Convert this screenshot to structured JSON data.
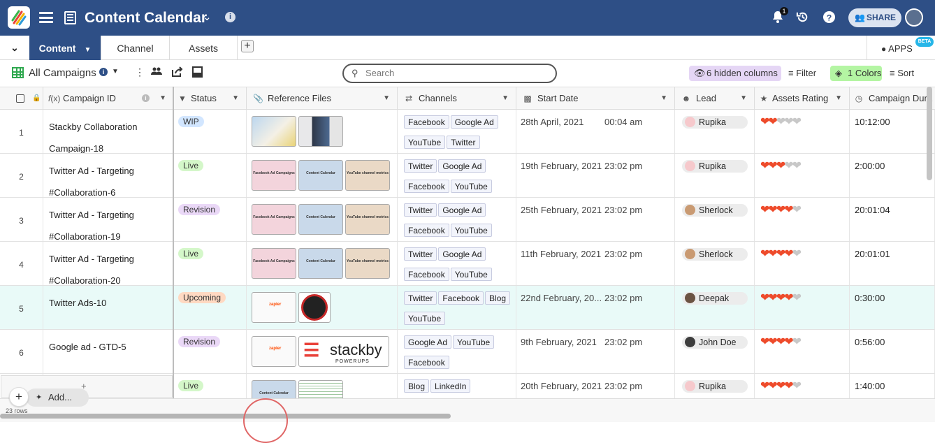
{
  "app": {
    "title": "Content Calendar",
    "notification_count": "1",
    "share_label": "SHARE"
  },
  "tabs": [
    {
      "label": "Content",
      "active": true
    },
    {
      "label": "Channel",
      "active": false
    },
    {
      "label": "Assets",
      "active": false
    }
  ],
  "apps": {
    "label": "APPS",
    "badge": "BETA"
  },
  "toolbar": {
    "view_name": "All Campaigns",
    "search_placeholder": "Search",
    "hidden_columns": "6 hidden columns",
    "filter": "Filter",
    "colors": "1 Colors",
    "sort": "Sort"
  },
  "columns": [
    {
      "label": "Campaign ID",
      "icon": "formula-icon"
    },
    {
      "label": "Status",
      "icon": "status-icon"
    },
    {
      "label": "Reference Files",
      "icon": "attachment-icon"
    },
    {
      "label": "Channels",
      "icon": "link-icon"
    },
    {
      "label": "Start Date",
      "icon": "calendar-icon"
    },
    {
      "label": "Lead",
      "icon": "person-icon"
    },
    {
      "label": "Assets Rating",
      "icon": "star-icon"
    },
    {
      "label": "Campaign Dura",
      "icon": "clock-icon"
    }
  ],
  "rows": [
    {
      "num": "1",
      "id1": "Stackby Collaboration",
      "id2": "Campaign-18",
      "status": "WIP",
      "status_color": "#d2e6ff",
      "files": [
        "photo-desk",
        "photo-laptop"
      ],
      "channels": [
        "Facebook",
        "Google Ad",
        "YouTube",
        "Twitter"
      ],
      "date": "28th April, 2021",
      "time": "00:04 am",
      "lead": "Rupika",
      "lead_color": "#f6c9cc",
      "rating": 2,
      "duration": "10:12:00"
    },
    {
      "num": "2",
      "id1": "Twitter Ad - Targeting",
      "id2": "#Collaboration-6",
      "status": "Live",
      "status_color": "#d4f7c9",
      "files": [
        "facebook-ad-campaigns",
        "content-calendar",
        "youtube-channel-metrics"
      ],
      "channels": [
        "Twitter",
        "Google Ad",
        "Facebook",
        "YouTube"
      ],
      "date": "19th February, 2021",
      "time": "23:02 pm",
      "lead": "Rupika",
      "lead_color": "#f6c9cc",
      "rating": 3,
      "duration": "2:00:00"
    },
    {
      "num": "3",
      "id1": "Twitter Ad - Targeting",
      "id2": "#Collaboration-19",
      "status": "Revision",
      "status_color": "#ead8f7",
      "files": [
        "facebook-ad-campaigns",
        "content-calendar",
        "youtube-channel-metrics"
      ],
      "channels": [
        "Twitter",
        "Google Ad",
        "Facebook",
        "YouTube"
      ],
      "date": "25th February, 2021",
      "time": "23:02 pm",
      "lead": "Sherlock",
      "lead_color": "#c99a72",
      "rating": 4,
      "duration": "20:01:04"
    },
    {
      "num": "4",
      "id1": "Twitter Ad - Targeting",
      "id2": "#Collaboration-20",
      "status": "Live",
      "status_color": "#d4f7c9",
      "files": [
        "facebook-ad-campaigns",
        "content-calendar",
        "youtube-channel-metrics"
      ],
      "channels": [
        "Twitter",
        "Google Ad",
        "Facebook",
        "YouTube"
      ],
      "date": "11th February, 2021",
      "time": "23:02 pm",
      "lead": "Sherlock",
      "lead_color": "#c99a72",
      "rating": 4,
      "duration": "20:01:01"
    },
    {
      "num": "5",
      "id1": "Twitter Ads-10",
      "id2": "",
      "status": "Upcoming",
      "status_color": "#ffd9c2",
      "files": [
        "zapier-flow",
        "badge-logo"
      ],
      "channels": [
        "Twitter",
        "Facebook",
        "Blog",
        "YouTube"
      ],
      "date": "22nd February, 20...",
      "time": "23:02 pm",
      "lead": "Deepak",
      "lead_color": "#6b5343",
      "rating": 4,
      "duration": "0:30:00"
    },
    {
      "num": "6",
      "id1": "Google ad - GTD-5",
      "id2": "",
      "status": "Revision",
      "status_color": "#ead8f7",
      "files": [
        "zapier-flow",
        "stackby-powerups"
      ],
      "channels": [
        "Google Ad",
        "YouTube",
        "Facebook"
      ],
      "date": "9th February, 2021",
      "time": "23:02 pm",
      "lead": "John Doe",
      "lead_color": "#3d3d3d",
      "rating": 4,
      "duration": "0:56:00"
    },
    {
      "num": "",
      "id1": "",
      "id2": "",
      "status": "Live",
      "status_color": "#d4f7c9",
      "files": [
        "content-calendar",
        "spreadsheet"
      ],
      "channels": [
        "Blog",
        "LinkedIn"
      ],
      "date": "20th February, 2021",
      "time": "23:02 pm",
      "lead": "Rupika",
      "lead_color": "#f6c9cc",
      "rating": 4,
      "duration": "1:40:00"
    }
  ],
  "thumb_text": {
    "fb": "Facebook Ad Campaigns",
    "cc": "Content Calendar",
    "yt": "YouTube channel metrics",
    "stackby": "stackby",
    "powerups": "POWERUPS",
    "zapier": "zapier"
  },
  "footer": {
    "add_label": "Add...",
    "row_count": "23 rows"
  },
  "colors": {
    "header_bg": "#2e4f86",
    "heart_on": "#ee4b2b",
    "heart_off": "#c8c8c8"
  }
}
